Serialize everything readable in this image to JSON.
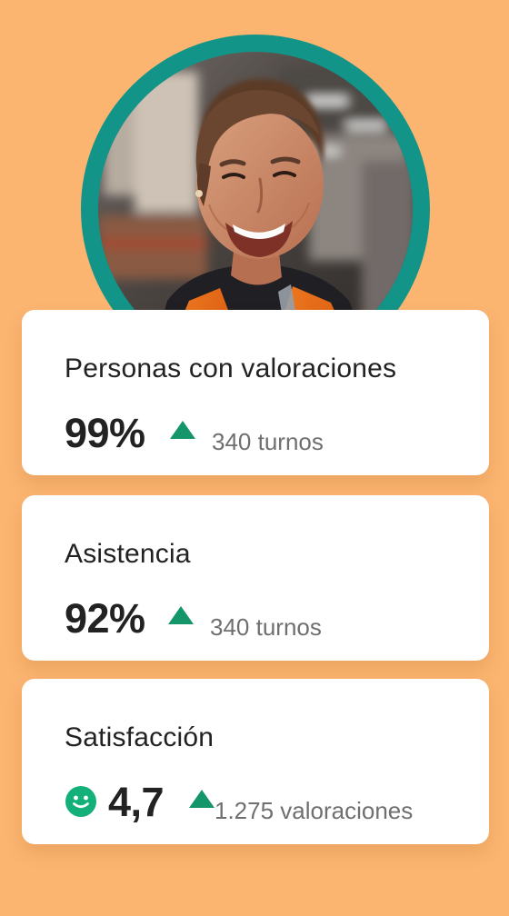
{
  "background_color": "#fbb571",
  "ring_color": "#139488",
  "trend_color": "#14966a",
  "cards": [
    {
      "title": "Personas con valoraciones",
      "value": "99%",
      "trend_icon": "up-triangle",
      "meta": "340 turnos"
    },
    {
      "title": "Asistencia",
      "value": "92%",
      "trend_icon": "up-triangle",
      "meta": "340 turnos"
    },
    {
      "title": "Satisfacción",
      "leading_icon": "smile-icon",
      "value": "4,7",
      "trend_icon": "up-triangle",
      "meta": "1.275 valoraciones"
    }
  ]
}
